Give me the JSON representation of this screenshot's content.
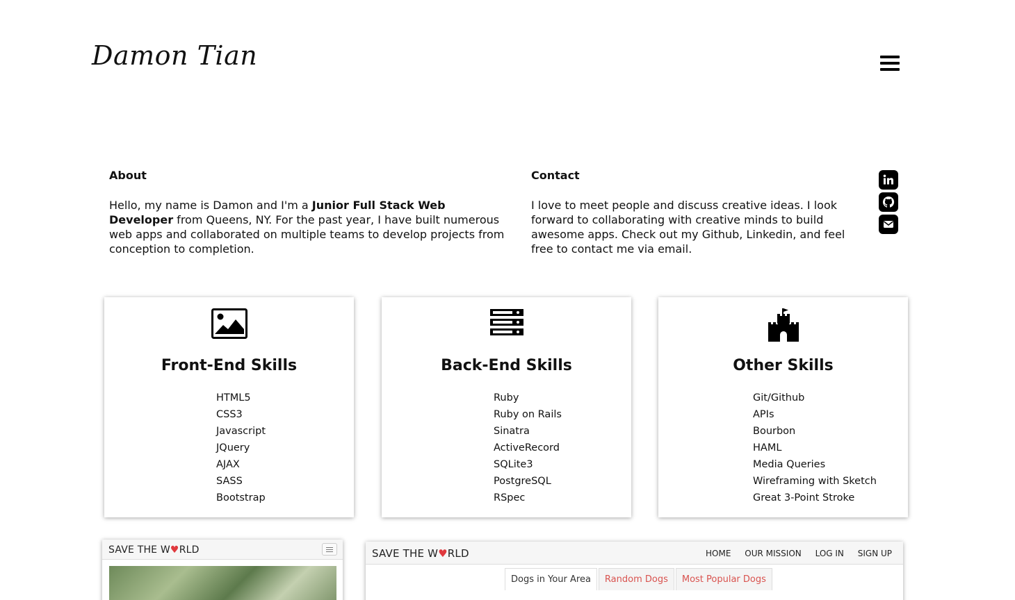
{
  "header": {
    "logo": "Damon Tian",
    "menu_icon": "hamburger-menu-icon"
  },
  "about": {
    "heading": "About",
    "text_before": "Hello, my name is Damon and I'm a ",
    "text_bold": "Junior Full Stack Web Developer",
    "text_after": " from Queens, NY. For the past year, I have built numerous web apps and collaborated on multiple teams to develop projects from conception to completion."
  },
  "contact": {
    "heading": "Contact",
    "text": "I love to meet people and discuss creative ideas. I look forward to collaborating with creative minds to build awesome apps. Check out my Github, Linkedin, and feel free to contact me via email.",
    "social_icons": [
      "linkedin-icon",
      "github-icon",
      "envelope-icon"
    ]
  },
  "skills": [
    {
      "title": "Front-End Skills",
      "icon": "image-icon",
      "items": [
        "HTML5",
        "CSS3",
        "Javascript",
        "JQuery",
        "AJAX",
        "SASS",
        "Bootstrap"
      ]
    },
    {
      "title": "Back-End Skills",
      "icon": "server-icon",
      "items": [
        "Ruby",
        "Ruby on Rails",
        "Sinatra",
        "ActiveRecord",
        "SQLite3",
        "PostgreSQL",
        "RSpec"
      ]
    },
    {
      "title": "Other Skills",
      "icon": "castle-icon",
      "items": [
        "Git/Github",
        "APIs",
        "Bourbon",
        "HAML",
        "Media Queries",
        "Wireframing with Sketch",
        "Great 3-Point Stroke"
      ]
    }
  ],
  "projects": {
    "mobile": {
      "brand_before": "SAVE THE W",
      "brand_after": "RLD"
    },
    "desktop": {
      "brand_before": "SAVE THE W",
      "brand_after": "RLD",
      "nav": [
        "HOME",
        "OUR MISSION",
        "LOG IN",
        "SIGN UP"
      ],
      "tabs": [
        "Dogs in Your Area",
        "Random Dogs",
        "Most Popular Dogs"
      ]
    }
  },
  "colors": {
    "text": "#111111",
    "accent_red": "#d9534f",
    "heart": "#e0393e"
  }
}
